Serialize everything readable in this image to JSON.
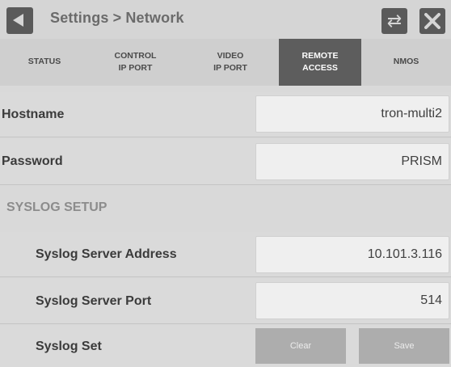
{
  "header": {
    "breadcrumb_parent": "Settings",
    "breadcrumb_separator": ">",
    "breadcrumb_current": "Network",
    "back_icon": "back-arrow-icon",
    "swap_icon": "swap-arrows-icon",
    "close_icon": "close-x-icon"
  },
  "tabs": [
    {
      "line1": "STATUS",
      "line2": "",
      "active": false
    },
    {
      "line1": "CONTROL",
      "line2": "IP PORT",
      "active": false
    },
    {
      "line1": "VIDEO",
      "line2": "IP PORT",
      "active": false
    },
    {
      "line1": "REMOTE",
      "line2": "ACCESS",
      "active": true
    },
    {
      "line1": "NMOS",
      "line2": "",
      "active": false
    }
  ],
  "fields": {
    "hostname": {
      "label": "Hostname",
      "value": "tron-multi2"
    },
    "password": {
      "label": "Password",
      "value": "PRISM"
    }
  },
  "syslog": {
    "section_title": "SYSLOG SETUP",
    "server_address": {
      "label": "Syslog Server Address",
      "value": "10.101.3.116"
    },
    "server_port": {
      "label": "Syslog Server Port",
      "value": "514"
    },
    "set": {
      "label": "Syslog Set",
      "clear_label": "Clear",
      "save_label": "Save"
    }
  },
  "colors": {
    "active_tab": "#5d5d5d",
    "icon_button": "#5a5a5a",
    "action_button": "#adadad"
  }
}
